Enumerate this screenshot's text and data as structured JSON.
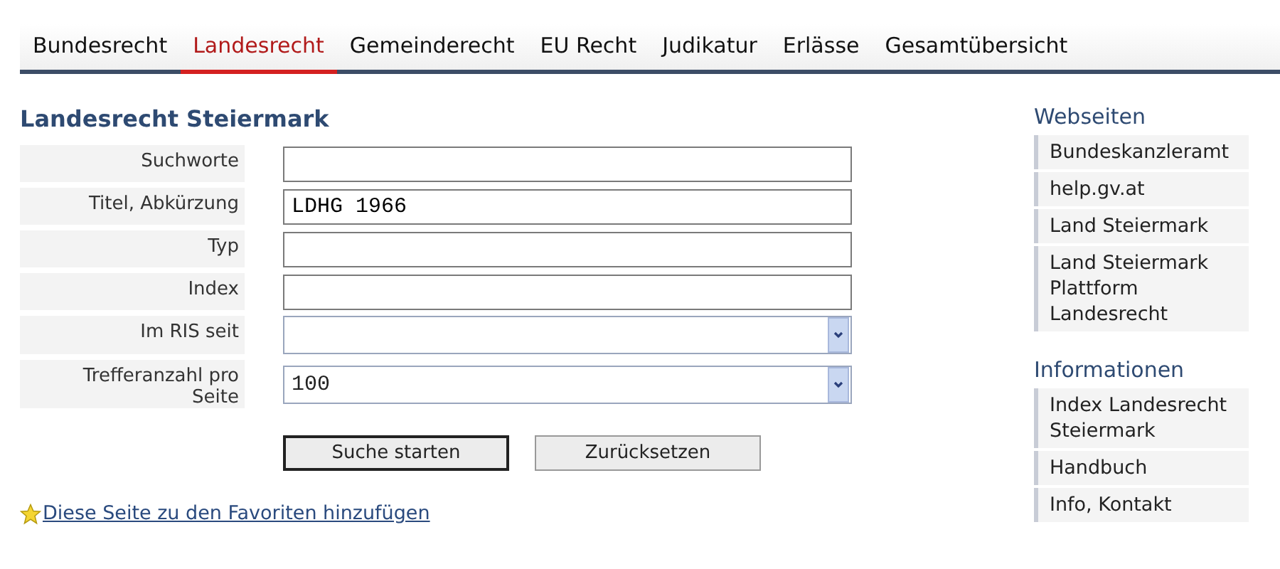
{
  "tabs": [
    {
      "label": "Bundesrecht",
      "selected": false
    },
    {
      "label": "Landesrecht",
      "selected": true
    },
    {
      "label": "Gemeinderecht",
      "selected": false
    },
    {
      "label": "EU Recht",
      "selected": false
    },
    {
      "label": "Judikatur",
      "selected": false
    },
    {
      "label": "Erlässe",
      "selected": false
    },
    {
      "label": "Gesamtübersicht",
      "selected": false
    }
  ],
  "page_title": "Landesrecht Steiermark",
  "form": [
    {
      "label": "Suchworte",
      "kind": "text"
    },
    {
      "label": "Titel, Abkürzung",
      "kind": "text",
      "value": "LDHG 1966"
    },
    {
      "label": "Typ",
      "kind": "text"
    },
    {
      "label": "Index",
      "kind": "text"
    },
    {
      "label": "Im RIS seit",
      "kind": "select"
    },
    {
      "label": "Trefferanzahl pro Seite",
      "kind": "select",
      "value": "100"
    }
  ],
  "buttons": [
    "Suche starten",
    "Zurücksetzen"
  ],
  "favorites_link": "Diese Seite zu den Favoriten hinzufügen",
  "sidebar": [
    {
      "heading": "Webseiten",
      "items": [
        "Bundeskanzleramt",
        "help.gv.at",
        "Land Steiermark",
        "Land Steiermark Plattform Landesrecht"
      ]
    },
    {
      "heading": "Informationen",
      "items": [
        "Index Landesrecht Steiermark",
        "Handbuch",
        "Info, Kontakt"
      ]
    }
  ]
}
